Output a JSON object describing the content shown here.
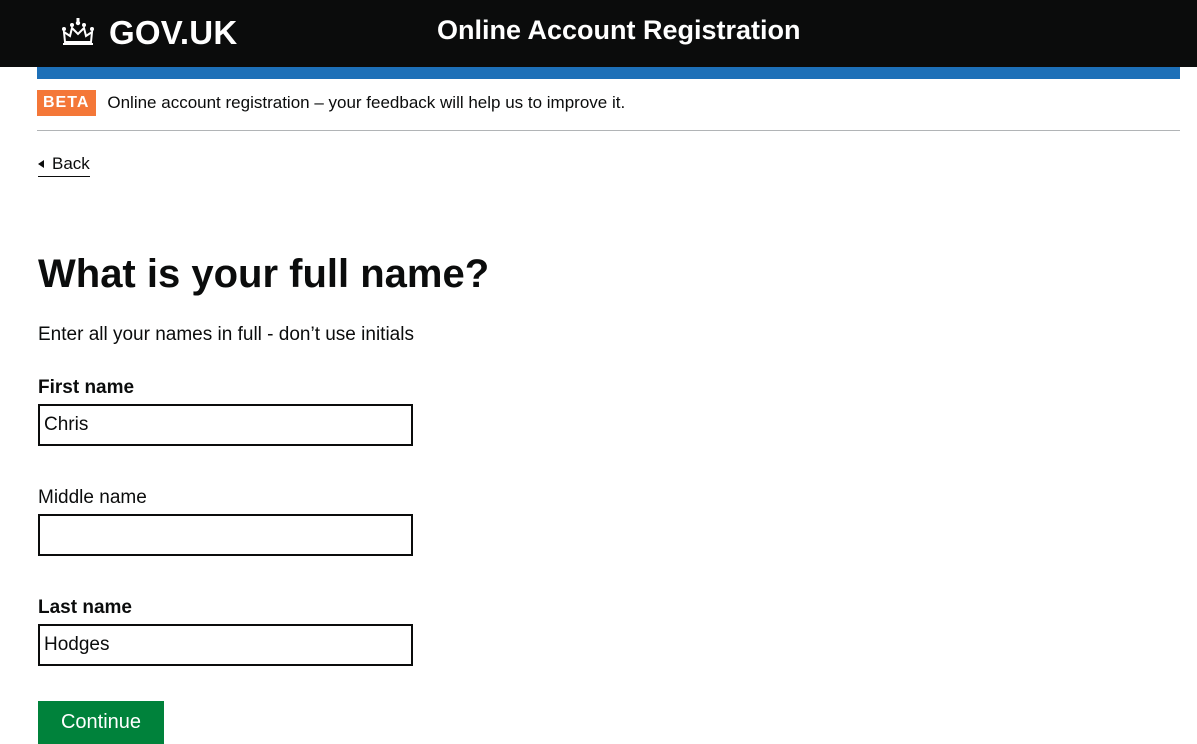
{
  "header": {
    "logo_text": "GOV.UK",
    "service_name": "Online Account Registration",
    "colors": {
      "background": "#0b0c0c",
      "bar": "#1d70b8"
    }
  },
  "phase_banner": {
    "tag": "BETA",
    "text": "Online account registration – your feedback will help us to improve it.",
    "tag_color": "#f47738"
  },
  "back_link": {
    "label": "Back"
  },
  "page": {
    "title": "What is your full name?",
    "hint": "Enter all your names in full - don’t use initials"
  },
  "form": {
    "first_name": {
      "label": "First name",
      "value": "Chris"
    },
    "middle_name": {
      "label": "Middle name",
      "value": ""
    },
    "last_name": {
      "label": "Last name",
      "value": "Hodges"
    },
    "continue_label": "Continue",
    "button_color": "#00823b"
  }
}
